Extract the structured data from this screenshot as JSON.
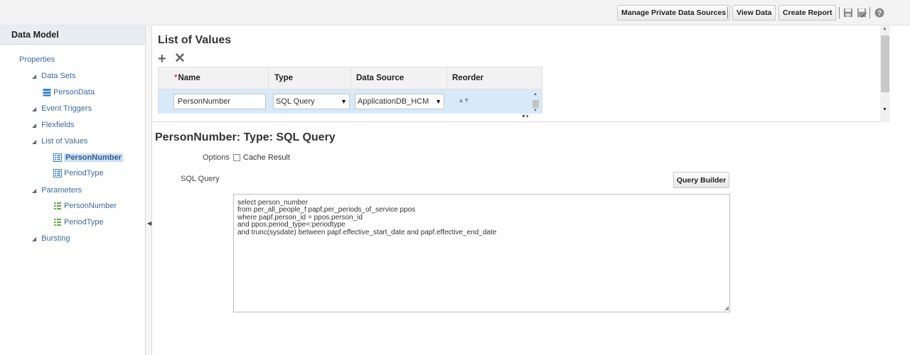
{
  "toolbar": {
    "manage_label": "Manage Private Data Sources",
    "view_data_label": "View Data",
    "create_report_label": "Create Report"
  },
  "left_panel": {
    "title": "Data Model",
    "tree": {
      "properties": "Properties",
      "data_sets": "Data Sets",
      "person_data": "PersonData",
      "event_triggers": "Event Triggers",
      "flexfields": "Flexfields",
      "list_of_values": "List of Values",
      "lov_person_number": "PersonNumber",
      "lov_period_type": "PeriodType",
      "parameters": "Parameters",
      "param_person_number": "PersonNumber",
      "param_period_type": "PeriodType",
      "bursting": "Bursting"
    }
  },
  "lov": {
    "title": "List of Values",
    "add_icon": "+",
    "delete_icon": "✕",
    "columns": {
      "required_marker": "*",
      "name": "Name",
      "type": "Type",
      "data_source": "Data Source",
      "reorder": "Reorder"
    },
    "row": {
      "name": "PersonNumber",
      "type": "SQL Query",
      "data_source": "ApplicationDB_HCM"
    }
  },
  "detail": {
    "title": "PersonNumber: Type: SQL Query",
    "options_label": "Options",
    "cache_result_label": "Cache Result",
    "sql_query_label": "SQL Query",
    "query_builder_label": "Query Builder",
    "sql_lines": [
      "select person_number",
      "from per_all_people_f papf,per_periods_of_service ppos",
      "where papf.person_id = ppos.person_id",
      "and ppos.period_type=:periodtype",
      "and trunc(sysdate) between papf.effective_start_date and papf.effective_end_date"
    ]
  },
  "colors": {
    "selected_row": "#d8e9f9",
    "link_blue": "#3a6b9e",
    "icon_blue": "#3b82c4",
    "icon_green": "#5aa83a"
  }
}
